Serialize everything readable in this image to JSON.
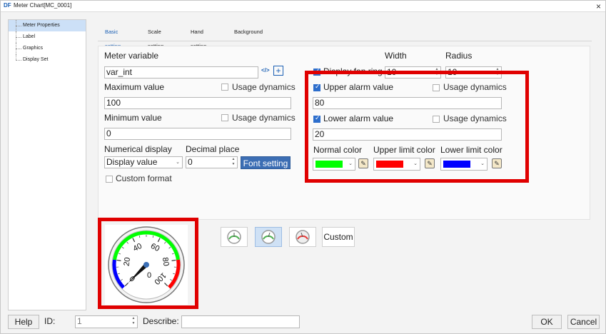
{
  "window": {
    "logo": "DF",
    "title": "Meter Chart[MC_0001]",
    "close": "×"
  },
  "tree": {
    "items": [
      "Meter Properties",
      "Label",
      "Graphics",
      "Display Set"
    ]
  },
  "tabs": [
    "Basic setting",
    "Scale setting",
    "Hand setting",
    "Background"
  ],
  "basic": {
    "meter_variable_label": "Meter variable",
    "meter_variable_value": "var_int",
    "code_icon": "</>",
    "plus_icon": "+",
    "max_label": "Maximum value",
    "max_value": "100",
    "min_label": "Minimum value",
    "min_value": "0",
    "usage_dynamics": "Usage dynamics",
    "numerical_display_label": "Numerical display",
    "numerical_display_value": "Display value",
    "decimal_place_label": "Decimal place",
    "decimal_place_value": "0",
    "font_setting": "Font setting",
    "custom_format": "Custom format",
    "width_label": "Width",
    "width_value": "10",
    "radius_label": "Radius",
    "radius_value": "10",
    "display_fan_ring": "Display fan ring",
    "upper_alarm_label": "Upper alarm value",
    "upper_alarm_value": "80",
    "lower_alarm_label": "Lower alarm value",
    "lower_alarm_value": "20",
    "normal_color_label": "Normal color",
    "upper_limit_color_label": "Upper limit color",
    "lower_limit_color_label": "Lower limit color",
    "colors": {
      "normal": "#00ff00",
      "upper": "#ff0000",
      "lower": "#0000ff"
    }
  },
  "gauge": {
    "ticks": [
      "0",
      "20",
      "40",
      "60",
      "80",
      "100"
    ],
    "value_label": "0",
    "value": 0,
    "min": 0,
    "max": 100,
    "lower_alarm": 20,
    "upper_alarm": 80
  },
  "preview_options": {
    "custom": "Custom"
  },
  "footer": {
    "help": "Help",
    "id_label": "ID:",
    "id_value": "1",
    "describe_label": "Describe:",
    "describe_value": "",
    "ok": "OK",
    "cancel": "Cancel"
  }
}
